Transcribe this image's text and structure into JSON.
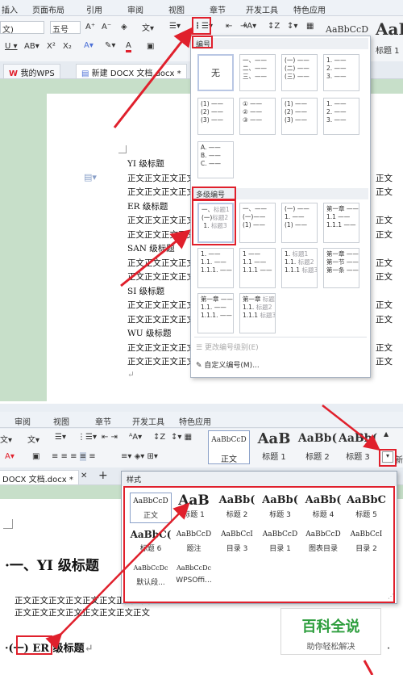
{
  "top": {
    "menu": [
      "插入",
      "页面布局",
      "引用",
      "审阅",
      "视图",
      "章节",
      "开发工具",
      "特色应用"
    ],
    "font_name": "文)",
    "font_size": "五号",
    "style_preview": "AaBbCcD",
    "style_preview_big": "AaB",
    "style_heading1": "标题 1",
    "tabs": [
      "我的WPS",
      "新建 DOCX 文档.docx *"
    ],
    "doc_lines": [
      {
        "text": "YI 级标题",
        "kind": "h"
      },
      {
        "text": "正文正文正文正文正文",
        "kind": "b"
      },
      {
        "text": "正文正文正文正文正文",
        "kind": "b"
      },
      {
        "text": "ER 级标题",
        "kind": "h"
      },
      {
        "text": "正文正文正文正文正文",
        "kind": "b"
      },
      {
        "text": "正文正文正文正文正文",
        "kind": "b"
      },
      {
        "text": "SAN 级标题",
        "kind": "h"
      },
      {
        "text": "正文正文正文正文正文",
        "kind": "b"
      },
      {
        "text": "正文正文正文正文正文",
        "kind": "b"
      },
      {
        "text": "SI 级标题",
        "kind": "h"
      },
      {
        "text": "正文正文正文正文正文",
        "kind": "b"
      },
      {
        "text": "正文正文正文正文正文",
        "kind": "b"
      },
      {
        "text": "WU 级标题",
        "kind": "h"
      },
      {
        "text": "正文正文正文正文正文",
        "kind": "b"
      },
      {
        "text": "正文正文正文正文正文",
        "kind": "b"
      }
    ],
    "right_text": "正文",
    "dropdown": {
      "section_numbering": "编号",
      "none": "无",
      "section_multilevel": "多级编号",
      "change_level": "更改编号级别(E)",
      "custom": "自定义编号(M)..."
    }
  },
  "bottom": {
    "menu": [
      "审阅",
      "视图",
      "章节",
      "开发工具",
      "特色应用"
    ],
    "gallery": [
      {
        "preview": "AaBbCcD",
        "name": "正文"
      },
      {
        "preview": "AaB",
        "name": "标题 1"
      },
      {
        "preview": "AaBb(",
        "name": "标题 2"
      },
      {
        "preview": "AaBb(",
        "name": "标题 3"
      }
    ],
    "new_label": "新",
    "tab": "DOCX 文档.docx *",
    "styles_title": "样式",
    "styles": [
      {
        "preview": "AaBbCcD",
        "name": "正文"
      },
      {
        "preview": "AaB",
        "name": "标题 1"
      },
      {
        "preview": "AaBb(",
        "name": "标题 2"
      },
      {
        "preview": "AaBb(",
        "name": "标题 3"
      },
      {
        "preview": "AaBb(",
        "name": "标题 4"
      },
      {
        "preview": "AaBbC",
        "name": "标题 5"
      },
      {
        "preview": "AaBbC(",
        "name": "标题 6"
      },
      {
        "preview": "AaBbCcD",
        "name": "题注"
      },
      {
        "preview": "AaBbCcI",
        "name": "目录 3"
      },
      {
        "preview": "AaBbCcD",
        "name": "目录 1"
      },
      {
        "preview": "AaBbCcD",
        "name": "图表目录"
      },
      {
        "preview": "AaBbCcI",
        "name": "目录 2"
      },
      {
        "preview": "AaBbCcDc",
        "name": "默认段..."
      },
      {
        "preview": "AaBbCcDc",
        "name": "WPSOffi..."
      }
    ],
    "heading1": "一、YI 级标题",
    "body_line": "正文正文正文正文正文正文正文正文",
    "heading2_num": "(一)",
    "heading2_text": "ER 级标题"
  },
  "watermark": {
    "title": "百科全说",
    "subtitle": "助你轻松解决"
  },
  "colors": {
    "annotation": "#e0202c",
    "doc_bg": "#c7dfc9",
    "heading_style": "#1f3a93"
  }
}
